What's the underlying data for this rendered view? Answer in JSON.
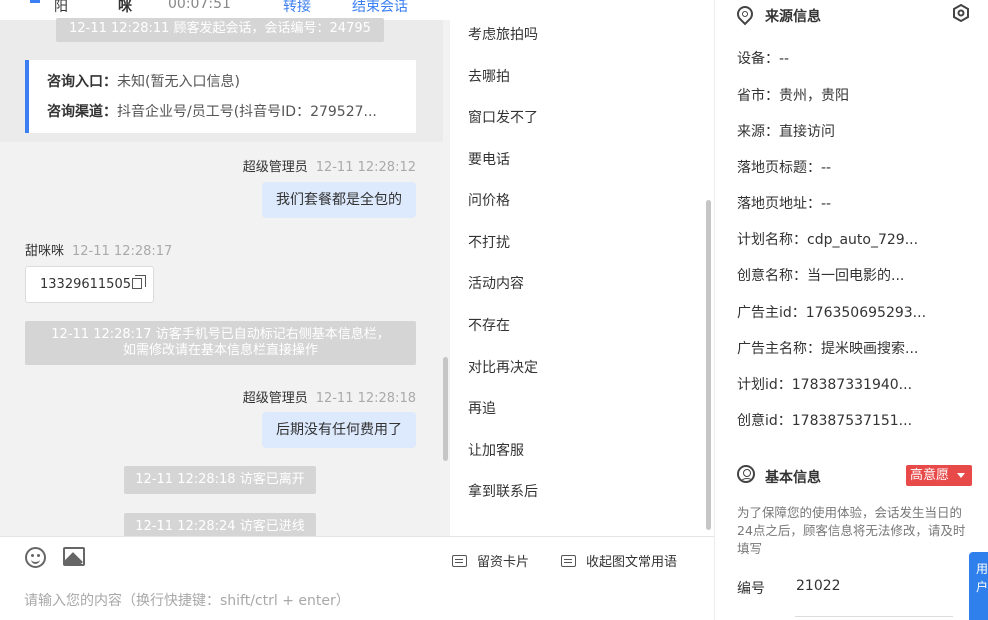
{
  "header_strip": {
    "name_a": "阳",
    "name_b": "咪",
    "duration": "00:07:51",
    "transfer": "转接",
    "end": "结束会话"
  },
  "system_messages": {
    "session_start": "12-11 12:28:11 顾客发起会话，会话编号：24795",
    "phone_marked": "12-11 12:28:17 访客手机号已自动标记右侧基本信息栏，\n如需修改请在基本信息栏直接操作",
    "left": "12-11 12:28:18 访客已离开",
    "joined": "12-11 12:28:24 访客已进线"
  },
  "source_card": {
    "entry_label": "咨询入口：",
    "entry_value": "未知(暂无入口信息)",
    "channel_label": "咨询渠道：",
    "channel_value": "抖音企业号/员工号(抖音号ID：279527..."
  },
  "messages": [
    {
      "sender": "超级管理员",
      "time": "12-11 12:28:12",
      "text": "我们套餐都是全包的"
    },
    {
      "sender": "甜咪咪",
      "time": "12-11 12:28:17",
      "text": "13329611505"
    },
    {
      "sender": "超级管理员",
      "time": "12-11 12:28:18",
      "text": "后期没有任何费用了"
    }
  ],
  "quick_replies": [
    "考虑旅拍吗",
    "去哪拍",
    "窗口发不了",
    "要电话",
    "问价格",
    "不打扰",
    "活动内容",
    "不存在",
    "对比再决定",
    "再追",
    "让加客服",
    "拿到联系后"
  ],
  "composer": {
    "card_label": "留资卡片",
    "phrases_label": "收起图文常用语",
    "placeholder": "请输入您的内容（换行快捷键：shift/ctrl + enter）"
  },
  "source_info": {
    "title": "来源信息",
    "fields": [
      "设备：--",
      "省市：贵州，贵阳",
      "来源：直接访问",
      "落地页标题：--",
      "落地页地址：--",
      "计划名称：cdp_auto_729...",
      "创意名称：当一回电影的...",
      "广告主id：176350695293...",
      "广告主名称：提米映画搜索...",
      "计划id：178387331940...",
      "创意id：178387537151..."
    ]
  },
  "basic_info": {
    "title": "基本信息",
    "intent_badge": "高意愿",
    "notice": "为了保障您的使用体验，会话发生当日的24点之后，顾客信息将无法修改，请及时填写",
    "id_label": "编号",
    "id_value": "21022"
  },
  "floating_button": {
    "text": "用户"
  },
  "colors": {
    "accent": "#3b7ff3",
    "badge_red": "#e84a4a",
    "agent_bubble": "#dde9fd",
    "system_gray": "#d5d5d6"
  }
}
